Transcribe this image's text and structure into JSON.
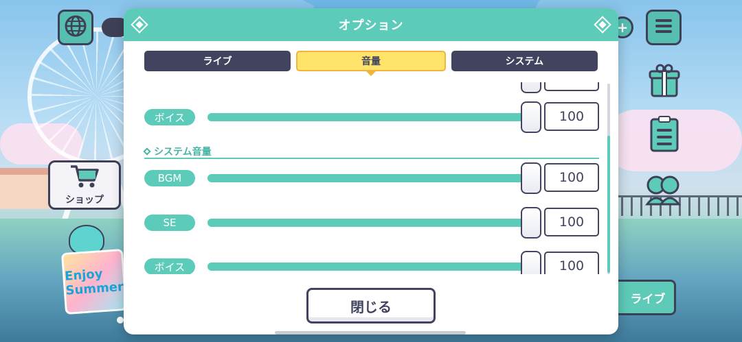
{
  "modal": {
    "title": "オプション",
    "tabs": [
      {
        "label": "ライブ",
        "active": false
      },
      {
        "label": "音量",
        "active": true
      },
      {
        "label": "システム",
        "active": false
      }
    ],
    "rows_top": [
      {
        "label": "ボイス",
        "value": "100",
        "level_percent": 100
      }
    ],
    "section_system": {
      "title": "システム音量",
      "rows": [
        {
          "label": "BGM",
          "value": "100",
          "level_percent": 100
        },
        {
          "label": "SE",
          "value": "100",
          "level_percent": 100
        },
        {
          "label": "ボイス",
          "value": "100",
          "level_percent": 100
        }
      ]
    },
    "close_label": "閉じる"
  },
  "background": {
    "shop_label": "ショップ",
    "live_label": "ライブ",
    "event_banner_text": "Enjoy Summer"
  },
  "colors": {
    "accent": "#5ccbb9",
    "dark": "#41435f",
    "active_tab": "#ffe36a"
  },
  "icons": [
    "globe-icon",
    "plus-icon",
    "menu-icon",
    "gift-icon",
    "list-icon",
    "friends-icon",
    "cart-icon",
    "diamond-icon"
  ]
}
